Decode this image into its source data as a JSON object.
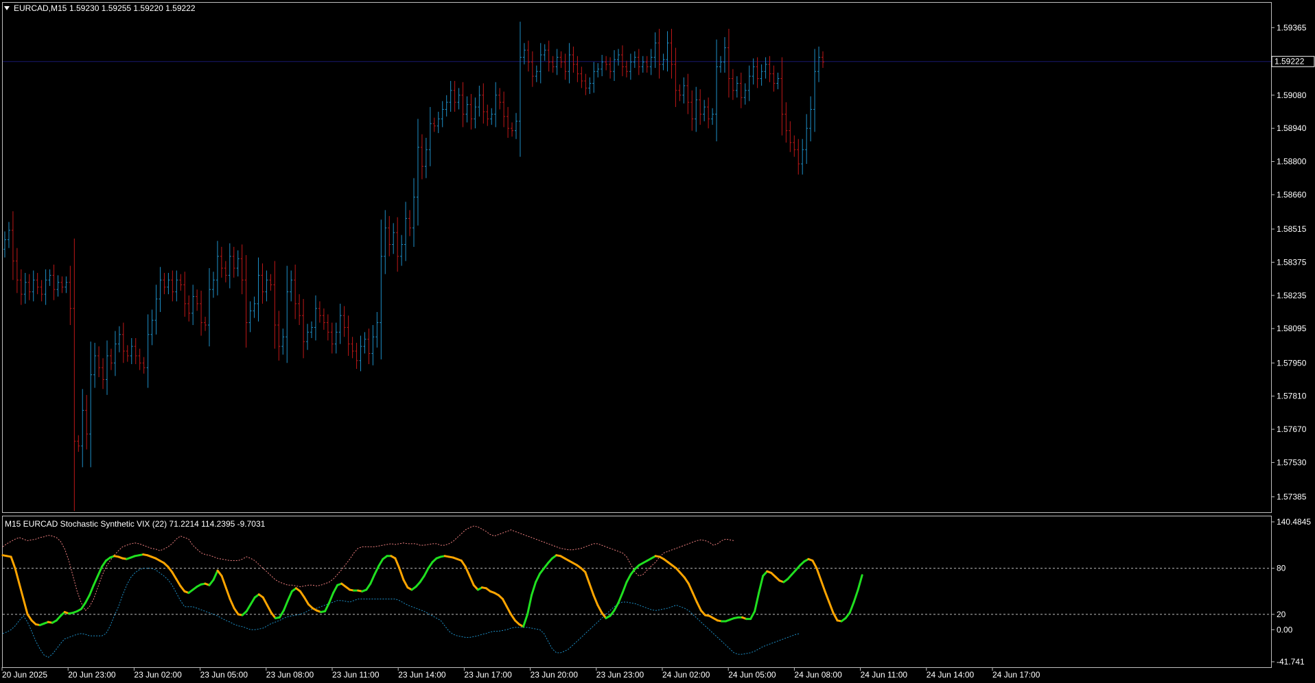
{
  "main_header": {
    "symbol": "EURCAD,M15",
    "ohlc": "1.59230 1.59255 1.59220 1.59222",
    "menu_icon": "triangle-down-icon"
  },
  "indicator_header": "M15 EURCAD Stochastic  Synthetic VIX (22) 71.2214 114.2395 -9.7031",
  "colors": {
    "background": "#000000",
    "frame": "#c0c0c0",
    "bull_candle": "#1e90c8",
    "bear_candle": "#c01818",
    "doji_candle": "#20e020",
    "current_price_line": "#191970",
    "stoch_up": "#20e020",
    "stoch_down": "#ffa500",
    "upper_band": "#f08080",
    "lower_band": "#1e90c8",
    "level_line": "#c0c0c0"
  },
  "chart_data": [
    {
      "type": "candlestick",
      "title": "EURCAD,M15",
      "ylim": [
        1.5732,
        1.5947
      ],
      "y_ticks": [
        "1.59365",
        "1.59080",
        "1.58940",
        "1.58800",
        "1.58660",
        "1.58515",
        "1.58375",
        "1.58235",
        "1.58095",
        "1.57950",
        "1.57810",
        "1.57670",
        "1.57530",
        "1.57385"
      ],
      "current_price": 1.59222,
      "current_price_label": "1.59222",
      "x_labels": [
        "20 Jun 2025",
        "20 Jun 23:00",
        "23 Jun 02:00",
        "23 Jun 05:00",
        "23 Jun 08:00",
        "23 Jun 11:00",
        "23 Jun 14:00",
        "23 Jun 17:00",
        "23 Jun 20:00",
        "23 Jun 23:00",
        "24 Jun 02:00",
        "24 Jun 05:00",
        "24 Jun 08:00",
        "24 Jun 11:00",
        "24 Jun 14:00",
        "24 Jun 17:00"
      ],
      "closes": [
        1.5847,
        1.5851,
        1.5838,
        1.583,
        1.5824,
        1.5829,
        1.5825,
        1.583,
        1.5827,
        1.5824,
        1.583,
        1.5832,
        1.5826,
        1.5829,
        1.5827,
        1.5829,
        1.5818,
        1.5762,
        1.576,
        1.5775,
        1.5765,
        1.579,
        1.5798,
        1.5793,
        1.5788,
        1.5798,
        1.5795,
        1.5803,
        1.5807,
        1.58,
        1.5798,
        1.5802,
        1.5798,
        1.5795,
        1.5793,
        1.5807,
        1.5813,
        1.5822,
        1.583,
        1.5827,
        1.583,
        1.5825,
        1.583,
        1.5828,
        1.582,
        1.5816,
        1.5823,
        1.582,
        1.5812,
        1.5811,
        1.5826,
        1.583,
        1.584,
        1.5835,
        1.5832,
        1.584,
        1.5835,
        1.5839,
        1.583,
        1.5812,
        1.5817,
        1.582,
        1.5832,
        1.5825,
        1.583,
        1.5828,
        1.5811,
        1.5802,
        1.5806,
        1.5825,
        1.583,
        1.582,
        1.5815,
        1.5804,
        1.5808,
        1.581,
        1.5818,
        1.5815,
        1.5812,
        1.5808,
        1.5803,
        1.5808,
        1.5815,
        1.581,
        1.5803,
        1.58,
        1.5796,
        1.5802,
        1.5805,
        1.5799,
        1.5806,
        1.5812,
        1.584,
        1.5852,
        1.5845,
        1.585,
        1.584,
        1.5845,
        1.5856,
        1.5852,
        1.5865,
        1.5886,
        1.5878,
        1.5885,
        1.5896,
        1.5895,
        1.5898,
        1.5902,
        1.5905,
        1.591,
        1.5905,
        1.5908,
        1.59,
        1.5904,
        1.5898,
        1.5903,
        1.5908,
        1.5901,
        1.5898,
        1.59,
        1.5908,
        1.5905,
        1.5899,
        1.5894,
        1.5893,
        1.5897,
        1.5924,
        1.5927,
        1.5922,
        1.5916,
        1.5918,
        1.5925,
        1.5927,
        1.5922,
        1.592,
        1.5924,
        1.5922,
        1.5918,
        1.5925,
        1.5921,
        1.5917,
        1.5914,
        1.5911,
        1.5913,
        1.5918,
        1.5919,
        1.5922,
        1.5921,
        1.5918,
        1.5923,
        1.5925,
        1.592,
        1.5918,
        1.5922,
        1.5924,
        1.592,
        1.5922,
        1.592,
        1.5924,
        1.593,
        1.5921,
        1.5923,
        1.593,
        1.5921,
        1.591,
        1.5908,
        1.5912,
        1.5905,
        1.5898,
        1.5906,
        1.59,
        1.5903,
        1.5898,
        1.59,
        1.592,
        1.5922,
        1.5928,
        1.5915,
        1.591,
        1.5913,
        1.5907,
        1.591,
        1.5916,
        1.592,
        1.5915,
        1.5918,
        1.5921,
        1.5917,
        1.5913,
        1.5915,
        1.59,
        1.5893,
        1.5888,
        1.5885,
        1.5879,
        1.5885,
        1.5894,
        1.5902,
        1.5918,
        1.5924,
        1.5922
      ]
    },
    {
      "type": "line",
      "title": "M15 EURCAD Stochastic  Synthetic VIX (22) 71.2214 114.2395 -9.7031",
      "ylim": [
        -41.741,
        140.4845
      ],
      "y_ticks": [
        "140.4845",
        "80",
        "20",
        "0.00",
        "-41.741"
      ],
      "levels": [
        80,
        20
      ],
      "series": [
        {
          "values": [
            97,
            96,
            95,
            80,
            60,
            40,
            20,
            12,
            7,
            6,
            8,
            10,
            9,
            12,
            18,
            23,
            21,
            22,
            24,
            27,
            35,
            45,
            58,
            70,
            82,
            90,
            94,
            96,
            95,
            93,
            92,
            94,
            96,
            97,
            98,
            97,
            95,
            93,
            90,
            87,
            82,
            75,
            66,
            57,
            50,
            48,
            52,
            56,
            59,
            60,
            58,
            65,
            77,
            70,
            55,
            40,
            28,
            20,
            19,
            24,
            33,
            42,
            46,
            42,
            32,
            22,
            15,
            16,
            25,
            38,
            50,
            54,
            50,
            42,
            33,
            28,
            25,
            23,
            24,
            35,
            48,
            58,
            60,
            56,
            52,
            51,
            51,
            50,
            52,
            60,
            72,
            83,
            92,
            96,
            96,
            93,
            80,
            65,
            55,
            52,
            56,
            62,
            70,
            80,
            88,
            93,
            95,
            96,
            95,
            94,
            92,
            90,
            82,
            70,
            58,
            52,
            55,
            54,
            50,
            48,
            45,
            40,
            30,
            20,
            12,
            7,
            4,
            20,
            45,
            62,
            73,
            80,
            87,
            93,
            97,
            96,
            93,
            90,
            87,
            84,
            80,
            75,
            60,
            45,
            32,
            22,
            15,
            18,
            25,
            35,
            48,
            62,
            72,
            79,
            84,
            87,
            90,
            93,
            96,
            95,
            92,
            88,
            84,
            80,
            74,
            68,
            60,
            48,
            36,
            25,
            19,
            18,
            15,
            12,
            11,
            11,
            13,
            15,
            16,
            16,
            14,
            14,
            24,
            48,
            70,
            76,
            74,
            69,
            64,
            62,
            66,
            72,
            78,
            84,
            89,
            92,
            90,
            80,
            65,
            50,
            36,
            22,
            12,
            11,
            15,
            22,
            36,
            52,
            71
          ]
        },
        {
          "values": [
            108,
            112,
            115,
            118,
            120,
            118,
            116,
            117,
            118,
            120,
            121,
            123,
            122,
            120,
            115,
            105,
            90,
            70,
            50,
            35,
            25,
            30,
            40,
            55,
            70,
            82,
            90,
            97,
            103,
            108,
            110,
            112,
            113,
            112,
            110,
            108,
            106,
            105,
            103,
            105,
            108,
            112,
            118,
            122,
            120,
            118,
            110,
            105,
            100,
            98,
            97,
            95,
            93,
            92,
            91,
            90,
            90,
            90,
            92,
            95,
            93,
            90,
            85,
            80,
            75,
            70,
            65,
            62,
            60,
            58,
            58,
            57,
            56,
            57,
            58,
            58,
            57,
            58,
            60,
            62,
            66,
            72,
            78,
            85,
            92,
            100,
            106,
            108,
            108,
            108,
            108,
            109,
            110,
            111,
            112,
            111,
            112,
            113,
            112,
            112,
            112,
            110,
            110,
            111,
            112,
            112,
            110,
            110,
            112,
            115,
            120,
            125,
            130,
            133,
            135,
            134,
            131,
            128,
            124,
            122,
            124,
            126,
            128,
            130,
            128,
            126,
            124,
            122,
            120,
            118,
            116,
            114,
            112,
            110,
            108,
            106,
            105,
            104,
            104,
            105,
            106,
            108,
            110,
            112,
            112,
            110,
            108,
            106,
            104,
            102,
            100,
            95,
            85,
            75,
            70,
            72,
            78,
            83,
            88,
            95,
            100,
            102,
            104,
            106,
            108,
            110,
            112,
            114,
            116,
            117,
            116,
            114,
            110,
            112,
            116,
            118,
            117,
            116
          ]
        },
        {
          "values": [
            -5,
            -3,
            0,
            5,
            12,
            18,
            10,
            -2,
            -15,
            -25,
            -33,
            -36,
            -32,
            -25,
            -18,
            -12,
            -10,
            -8,
            -6,
            -5,
            -6,
            -8,
            -8,
            -8,
            -8,
            -5,
            5,
            18,
            30,
            45,
            58,
            68,
            74,
            78,
            80,
            80,
            80,
            78,
            74,
            70,
            65,
            58,
            48,
            38,
            30,
            30,
            30,
            28,
            26,
            24,
            22,
            20,
            18,
            15,
            12,
            10,
            7,
            5,
            4,
            2,
            0,
            0,
            1,
            2,
            5,
            8,
            10,
            12,
            15,
            17,
            18,
            19,
            20,
            22,
            25,
            27,
            28,
            30,
            32,
            34,
            36,
            38,
            38,
            37,
            36,
            38,
            40,
            40,
            40,
            40,
            40,
            40,
            40,
            40,
            40,
            40,
            38,
            35,
            32,
            30,
            28,
            26,
            24,
            21,
            18,
            15,
            12,
            5,
            -2,
            -6,
            -8,
            -9,
            -10,
            -10,
            -9,
            -8,
            -6,
            -5,
            -3,
            -2,
            -2,
            -1,
            0,
            2,
            3,
            3,
            3,
            3,
            2,
            1,
            0,
            -5,
            -15,
            -25,
            -30,
            -30,
            -28,
            -25,
            -20,
            -15,
            -10,
            -5,
            0,
            5,
            10,
            15,
            20,
            25,
            30,
            34,
            36,
            36,
            35,
            34,
            32,
            30,
            28,
            26,
            25,
            26,
            27,
            28,
            30,
            32,
            30,
            28,
            25,
            20,
            15,
            10,
            5,
            0,
            -5,
            -10,
            -15,
            -20,
            -25,
            -30,
            -32,
            -32,
            -31,
            -30,
            -28,
            -25,
            -22,
            -20,
            -18,
            -16,
            -14,
            -12,
            -10,
            -8,
            -6,
            -5
          ]
        }
      ]
    }
  ]
}
